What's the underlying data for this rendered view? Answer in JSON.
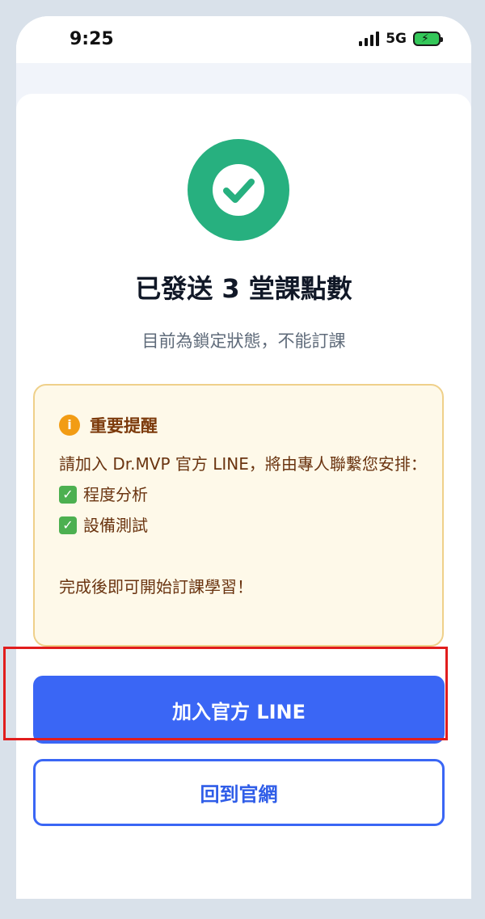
{
  "status_bar": {
    "time": "9:25",
    "network": "5G",
    "icons": [
      "signal-icon",
      "battery-charging-icon"
    ]
  },
  "result": {
    "title": "已發送 3 堂課點數",
    "subtitle": "目前為鎖定狀態，不能訂課",
    "icon": "check-circle-icon",
    "accent": "#27b07f"
  },
  "notice": {
    "icon": "info-icon",
    "title": "重要提醒",
    "body_line": "請加入 Dr.MVP 官方 LINE，將由專人聯繫您安排：",
    "items": [
      "程度分析",
      "設備測試"
    ],
    "footer": "完成後即可開始訂課學習！",
    "colors": {
      "background": "#fef9e9",
      "border": "#efd08a",
      "text": "#6a3410"
    }
  },
  "actions": {
    "primary_label": "加入官方 LINE",
    "secondary_label": "回到官網",
    "primary_color": "#3a66f5",
    "highlight_color": "#e11d1d"
  }
}
